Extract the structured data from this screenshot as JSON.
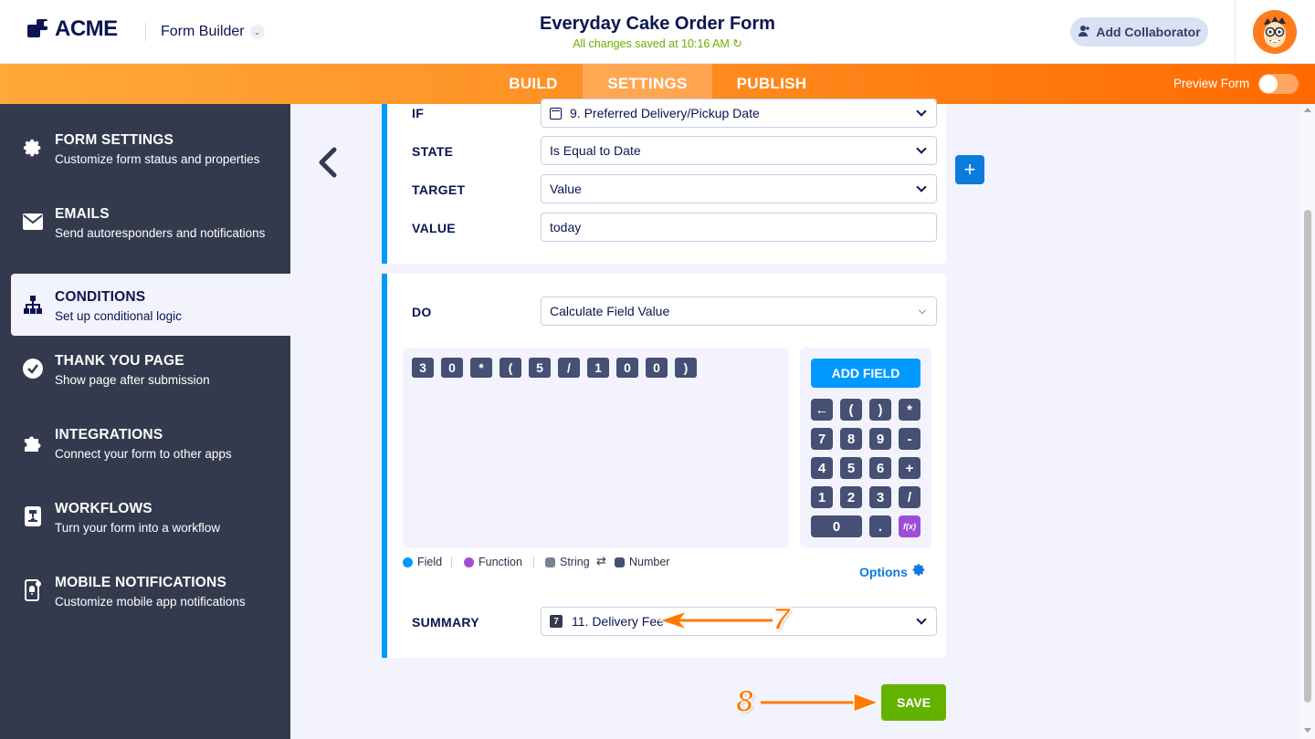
{
  "header": {
    "logo_text": "ACME",
    "app_name": "Form Builder",
    "form_title": "Everyday Cake Order Form",
    "save_status": "All changes saved at 10:16 AM",
    "collaborator_button": "Add Collaborator"
  },
  "nav": {
    "tabs": [
      {
        "label": "BUILD",
        "active": false
      },
      {
        "label": "SETTINGS",
        "active": true
      },
      {
        "label": "PUBLISH",
        "active": false
      }
    ],
    "preview_label": "Preview Form",
    "preview_on": false
  },
  "sidebar": {
    "items": [
      {
        "title": "FORM SETTINGS",
        "desc": "Customize form status and properties",
        "icon": "gear-icon"
      },
      {
        "title": "EMAILS",
        "desc": "Send autoresponders and notifications",
        "icon": "envelope-icon"
      },
      {
        "title": "CONDITIONS",
        "desc": "Set up conditional logic",
        "icon": "sitemap-icon",
        "active": true
      },
      {
        "title": "THANK YOU PAGE",
        "desc": "Show page after submission",
        "icon": "check-circle-icon"
      },
      {
        "title": "INTEGRATIONS",
        "desc": "Connect your form to other apps",
        "icon": "puzzle-icon"
      },
      {
        "title": "WORKFLOWS",
        "desc": "Turn your form into a workflow",
        "icon": "workflow-icon"
      },
      {
        "title": "MOBILE NOTIFICATIONS",
        "desc": "Customize mobile app notifications",
        "icon": "mobile-bell-icon"
      }
    ]
  },
  "condition": {
    "if_label": "IF",
    "if_value": "9. Preferred Delivery/Pickup Date",
    "state_label": "STATE",
    "state_value": "Is Equal to Date",
    "target_label": "TARGET",
    "target_value": "Value",
    "value_label": "VALUE",
    "value_value": "today"
  },
  "action": {
    "do_label": "DO",
    "do_value": "Calculate Field Value",
    "formula_tokens": [
      "3",
      "0",
      "*",
      "(",
      "5",
      "/",
      "1",
      "0",
      "0",
      ")"
    ],
    "add_field_label": "ADD FIELD",
    "keypad": [
      [
        "←",
        "(",
        ")",
        "*"
      ],
      [
        "7",
        "8",
        "9",
        "-"
      ],
      [
        "4",
        "5",
        "6",
        "+"
      ],
      [
        "1",
        "2",
        "3",
        "/"
      ],
      [
        "0",
        ".",
        "f(x)"
      ]
    ],
    "legend": {
      "field": "Field",
      "function": "Function",
      "string": "String",
      "number": "Number"
    },
    "options_label": "Options",
    "summary_label": "SUMMARY",
    "summary_icon_text": "7",
    "summary_value": "11. Delivery Fee"
  },
  "save_label": "SAVE",
  "annotations": {
    "step_7": "7",
    "step_8": "8"
  },
  "colors": {
    "accent_blue": "#0099ff",
    "save_green": "#64b200",
    "nav_orange": "#ff8a1e",
    "sidebar_dark": "#343a4e",
    "function_purple": "#9c4fd6",
    "annotation_orange": "#ff7a00"
  }
}
